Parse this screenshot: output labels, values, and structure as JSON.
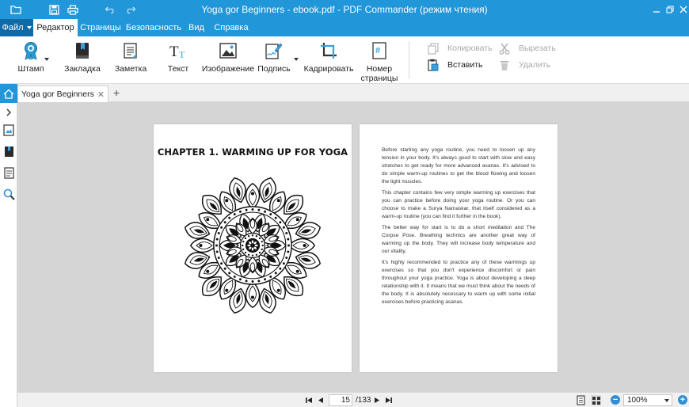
{
  "window": {
    "title": "Yoga gor Beginners - ebook.pdf - PDF Commander (режим чтения)"
  },
  "menu": {
    "file_label": "Файл",
    "tabs": [
      {
        "label": "Редактор",
        "active": true
      },
      {
        "label": "Страницы",
        "active": false
      },
      {
        "label": "Безопасность",
        "active": false
      },
      {
        "label": "Вид",
        "active": false
      },
      {
        "label": "Справка",
        "active": false
      }
    ]
  },
  "ribbon": {
    "stamp": "Штамп",
    "bookmark": "Закладка",
    "note": "Заметка",
    "text": "Текст",
    "image": "Изображение",
    "signature": "Подпись",
    "crop": "Кадрировать",
    "page_number_line1": "Номер",
    "page_number_line2": "страницы",
    "copy": "Копировать",
    "paste": "Вставить",
    "cut": "Вырезать",
    "delete": "Удалить"
  },
  "tabs": {
    "doc_tab_title": "Yoga gor Beginners - ebook.pdf"
  },
  "document": {
    "left_page_title": "CHAPTER 1. WARMING UP FOR YOGA",
    "right_page_paragraphs": [
      "Before starting any yoga routine, you need to loosen up any tension in your body. It's always good to start with slow and easy stretches to get ready for more advanced asanas. It's advised to do simple warm-up routines to get the blood flowing and loosen the tight muscles.",
      "This chapter contains few very simple warming up exercises that you can practice before doing your yoga routine. Or you can choose to make a Surya Namaskar, that itself considered as a warm-up routine (you can find it further in the book).",
      "The better way for start is to do a short meditation and The Corpse Pose. Breathing technics are another great way of warming up the body. They will increase body temperature and our vitality.",
      "It's highly recommended to practice any of these warmings up exercises so that you don't experience discomfort or pain throughout your yoga practice. Yoga is about developing a deep relationship with it. It means that we must think about the needs of the body. It is absolutely necessary to warm up with some initial exercises before practicing asanas."
    ]
  },
  "status": {
    "current_page": "15",
    "total_pages": "/133",
    "zoom": "100%"
  },
  "colors": {
    "accent": "#2196d8",
    "file_button": "#0f6aa8",
    "doc_background": "#d5d5d5"
  }
}
